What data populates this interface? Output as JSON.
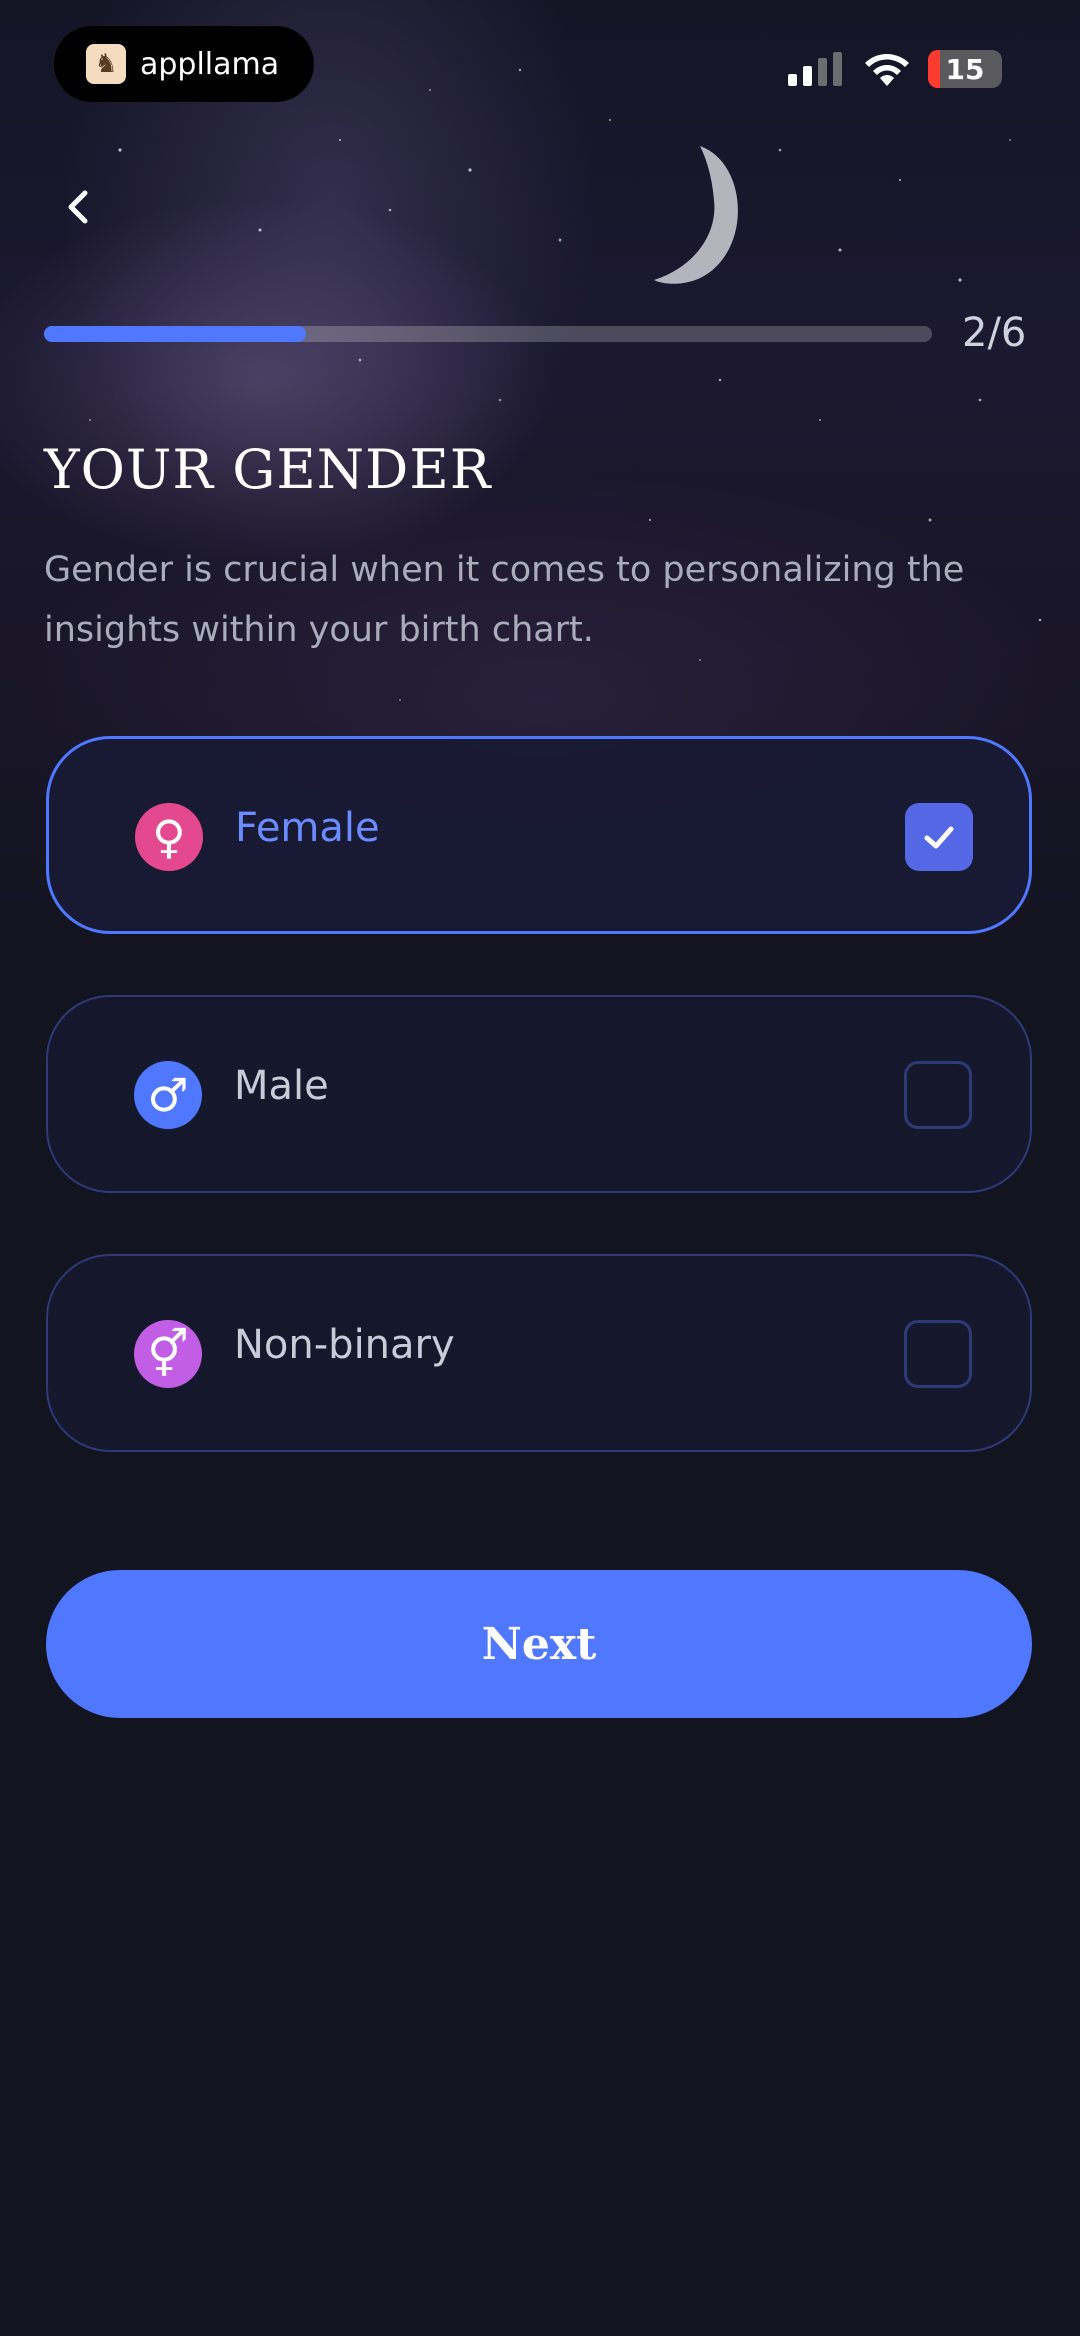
{
  "status_bar": {
    "app_name": "appllama",
    "battery": "15"
  },
  "progress": {
    "label": "2/6",
    "fraction": 0.2955
  },
  "header": {
    "title": "YOUR GENDER",
    "subtitle": "Gender is crucial when it comes to personalizing the insights within your birth chart."
  },
  "options": [
    {
      "label": "Female",
      "icon": "female-symbol-icon",
      "color": "#e4498f",
      "selected": true
    },
    {
      "label": "Male",
      "icon": "male-symbol-icon",
      "color": "#4f78ff",
      "selected": false
    },
    {
      "label": "Non-binary",
      "icon": "non-binary-symbol-icon",
      "color": "#c25ee6",
      "selected": false
    }
  ],
  "next_button": {
    "label": "Next"
  },
  "colors": {
    "accent": "#4f78ff",
    "background": "#12141f",
    "checkbox_checked": "#5468e6"
  }
}
